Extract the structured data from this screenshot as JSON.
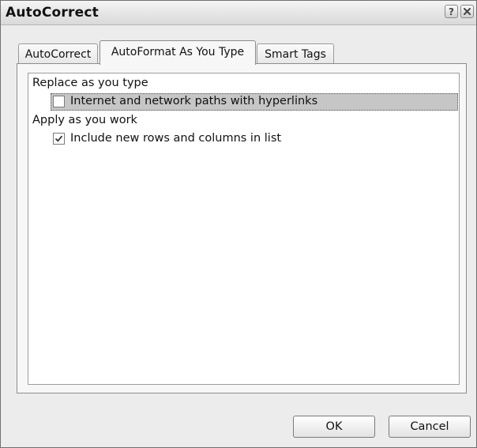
{
  "window": {
    "title": "AutoCorrect",
    "help_icon": "help-question-icon",
    "close_icon": "close-x-icon"
  },
  "tabs": [
    {
      "label": "AutoCorrect",
      "active": false
    },
    {
      "label": "AutoFormat As You Type",
      "active": true
    },
    {
      "label": "Smart Tags",
      "active": false
    }
  ],
  "groups": {
    "replace_heading": "Replace as you type",
    "apply_heading": "Apply as you work"
  },
  "options": [
    {
      "label": "Internet and network paths with hyperlinks",
      "checked": false,
      "selected": true
    },
    {
      "label": "Include new rows and columns in list",
      "checked": true,
      "selected": false
    }
  ],
  "buttons": {
    "ok": "OK",
    "cancel": "Cancel"
  },
  "colors": {
    "selection_highlight": "#c6c6c6",
    "dialog_background": "#ececec"
  }
}
